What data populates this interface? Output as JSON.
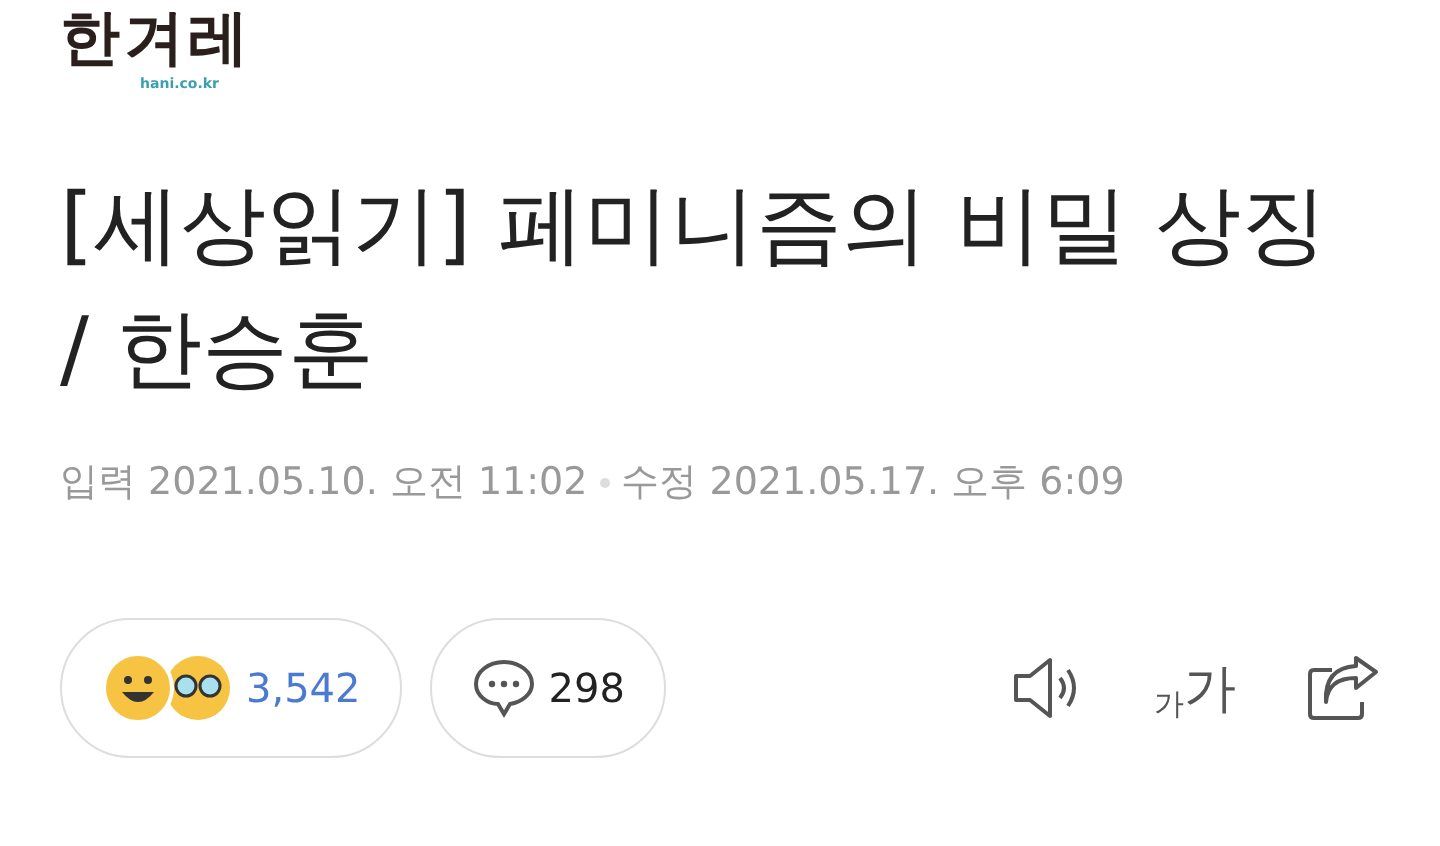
{
  "logo": {
    "name": "한겨레",
    "domain": "hani.co.kr"
  },
  "headline": "[세상읽기] 페미니즘의 비밀 상징 / 한승훈",
  "meta": {
    "published_label": "입력",
    "published": "2021.05.10. 오전 11:02",
    "modified_label": "수정",
    "modified": "2021.05.17. 오후 6:09"
  },
  "reactions": {
    "count": "3,542"
  },
  "comments": {
    "count": "298"
  },
  "font_size": {
    "small": "가",
    "large": "가"
  }
}
